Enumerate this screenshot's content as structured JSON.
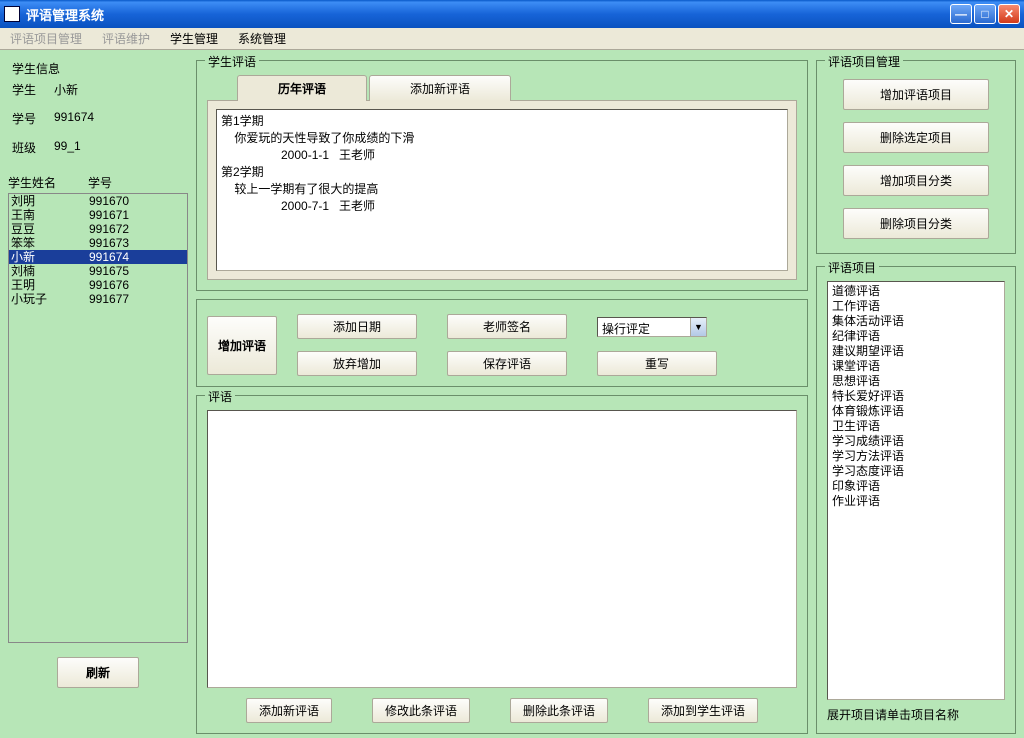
{
  "window": {
    "title": "评语管理系统"
  },
  "menu": {
    "item1": "评语项目管理",
    "item2": "评语维护",
    "item3": "学生管理",
    "item4": "系统管理"
  },
  "studentInfo": {
    "legend": "学生信息",
    "nameLabel": "学生",
    "name": "小新",
    "idLabel": "学号",
    "id": "991674",
    "classLabel": "班级",
    "class": "99_1"
  },
  "listHeader": {
    "col1": "学生姓名",
    "col2": "学号"
  },
  "students": [
    {
      "name": "刘明",
      "id": "991670",
      "selected": false
    },
    {
      "name": "王南",
      "id": "991671",
      "selected": false
    },
    {
      "name": "豆豆",
      "id": "991672",
      "selected": false
    },
    {
      "name": "笨笨",
      "id": "991673",
      "selected": false
    },
    {
      "name": "小新",
      "id": "991674",
      "selected": true
    },
    {
      "name": "刘楠",
      "id": "991675",
      "selected": false
    },
    {
      "name": "王明",
      "id": "991676",
      "selected": false
    },
    {
      "name": "小玩子",
      "id": "991677",
      "selected": false
    }
  ],
  "refreshBtn": "刷新",
  "studentComment": {
    "legend": "学生评语",
    "tab1": "历年评语",
    "tab2": "添加新评语",
    "history": "第1学期\n    你爱玩的天性导致了你成绩的下滑\n                  2000-1-1   王老师\n第2学期\n    较上一学期有了很大的提高\n                  2000-7-1   王老师"
  },
  "actions": {
    "addComment": "增加评语",
    "addDate": "添加日期",
    "teacherSign": "老师签名",
    "ratingLabel": "操行评定",
    "abandon": "放弃增加",
    "save": "保存评语",
    "rewrite": "重写"
  },
  "commentBox": {
    "legend": "评语"
  },
  "bottomBtns": {
    "addNew": "添加新评语",
    "edit": "修改此条评语",
    "delete": "删除此条评语",
    "addToStudent": "添加到学生评语"
  },
  "mgmt": {
    "legend": "评语项目管理",
    "b1": "增加评语项目",
    "b2": "删除选定项目",
    "b3": "增加项目分类",
    "b4": "删除项目分类"
  },
  "categories": {
    "legend": "评语项目",
    "items": [
      "道德评语",
      "工作评语",
      "集体活动评语",
      "纪律评语",
      "建议期望评语",
      "课堂评语",
      "思想评语",
      "特长爱好评语",
      "体育锻炼评语",
      "卫生评语",
      "学习成绩评语",
      "学习方法评语",
      "学习态度评语",
      "印象评语",
      "作业评语"
    ],
    "hint": "展开项目请单击项目名称"
  }
}
